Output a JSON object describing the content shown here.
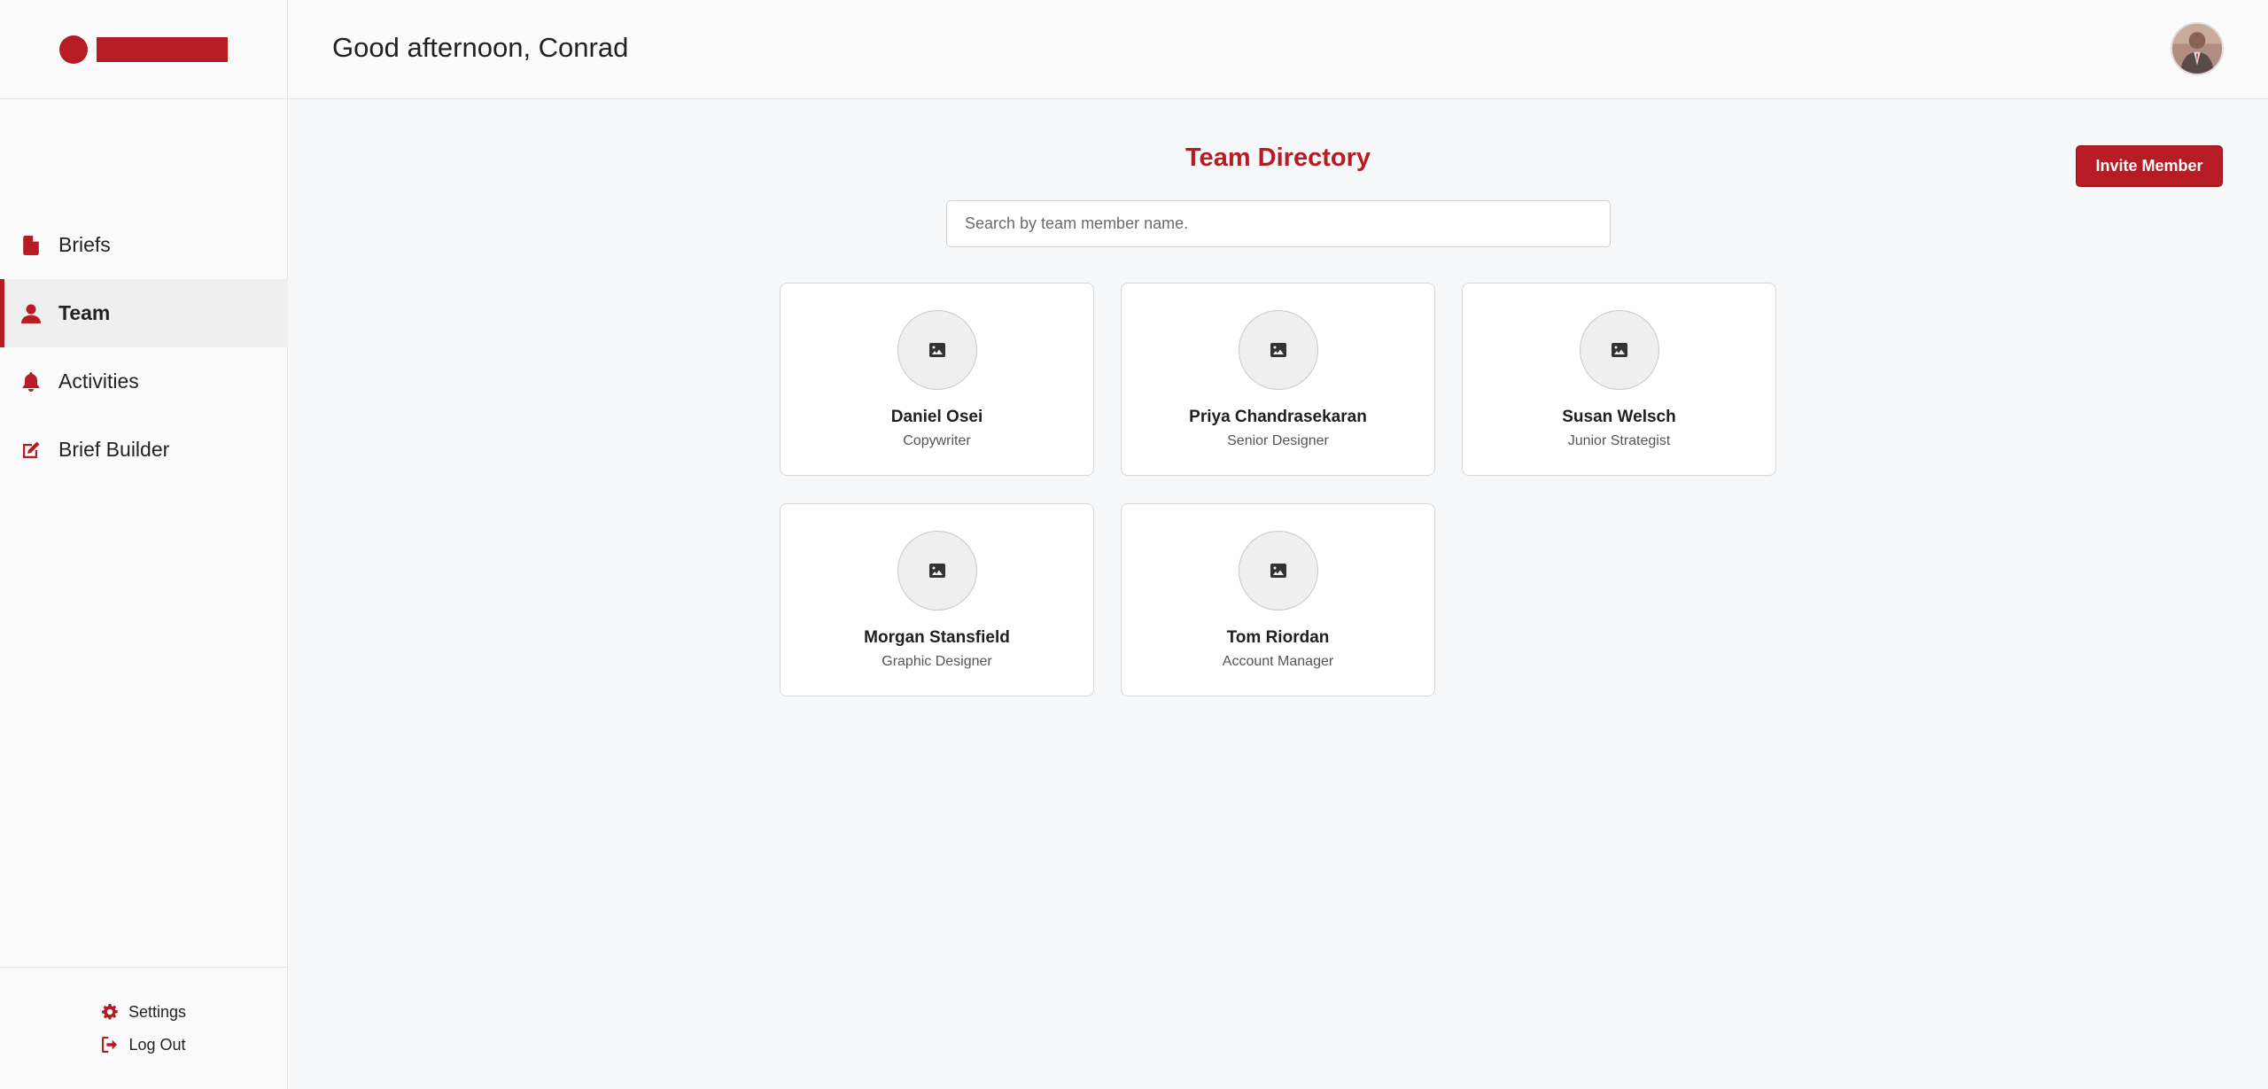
{
  "header": {
    "greeting": "Good afternoon, Conrad"
  },
  "brand": {
    "accent_color": "#b71c24"
  },
  "sidebar": {
    "items": [
      {
        "label": "Briefs",
        "icon": "file-icon",
        "active": false
      },
      {
        "label": "Team",
        "icon": "user-icon",
        "active": true
      },
      {
        "label": "Activities",
        "icon": "bell-icon",
        "active": false
      },
      {
        "label": "Brief Builder",
        "icon": "edit-icon",
        "active": false
      }
    ],
    "footer": {
      "settings_label": "Settings",
      "logout_label": "Log Out"
    }
  },
  "main": {
    "title": "Team Directory",
    "invite_label": "Invite Member",
    "search_placeholder": "Search by team member name.",
    "members": [
      {
        "name": "Daniel Osei",
        "role": "Copywriter"
      },
      {
        "name": "Priya Chandrasekaran",
        "role": "Senior Designer"
      },
      {
        "name": "Susan Welsch",
        "role": "Junior Strategist"
      },
      {
        "name": "Morgan Stansfield",
        "role": "Graphic Designer"
      },
      {
        "name": "Tom Riordan",
        "role": "Account Manager"
      }
    ]
  }
}
